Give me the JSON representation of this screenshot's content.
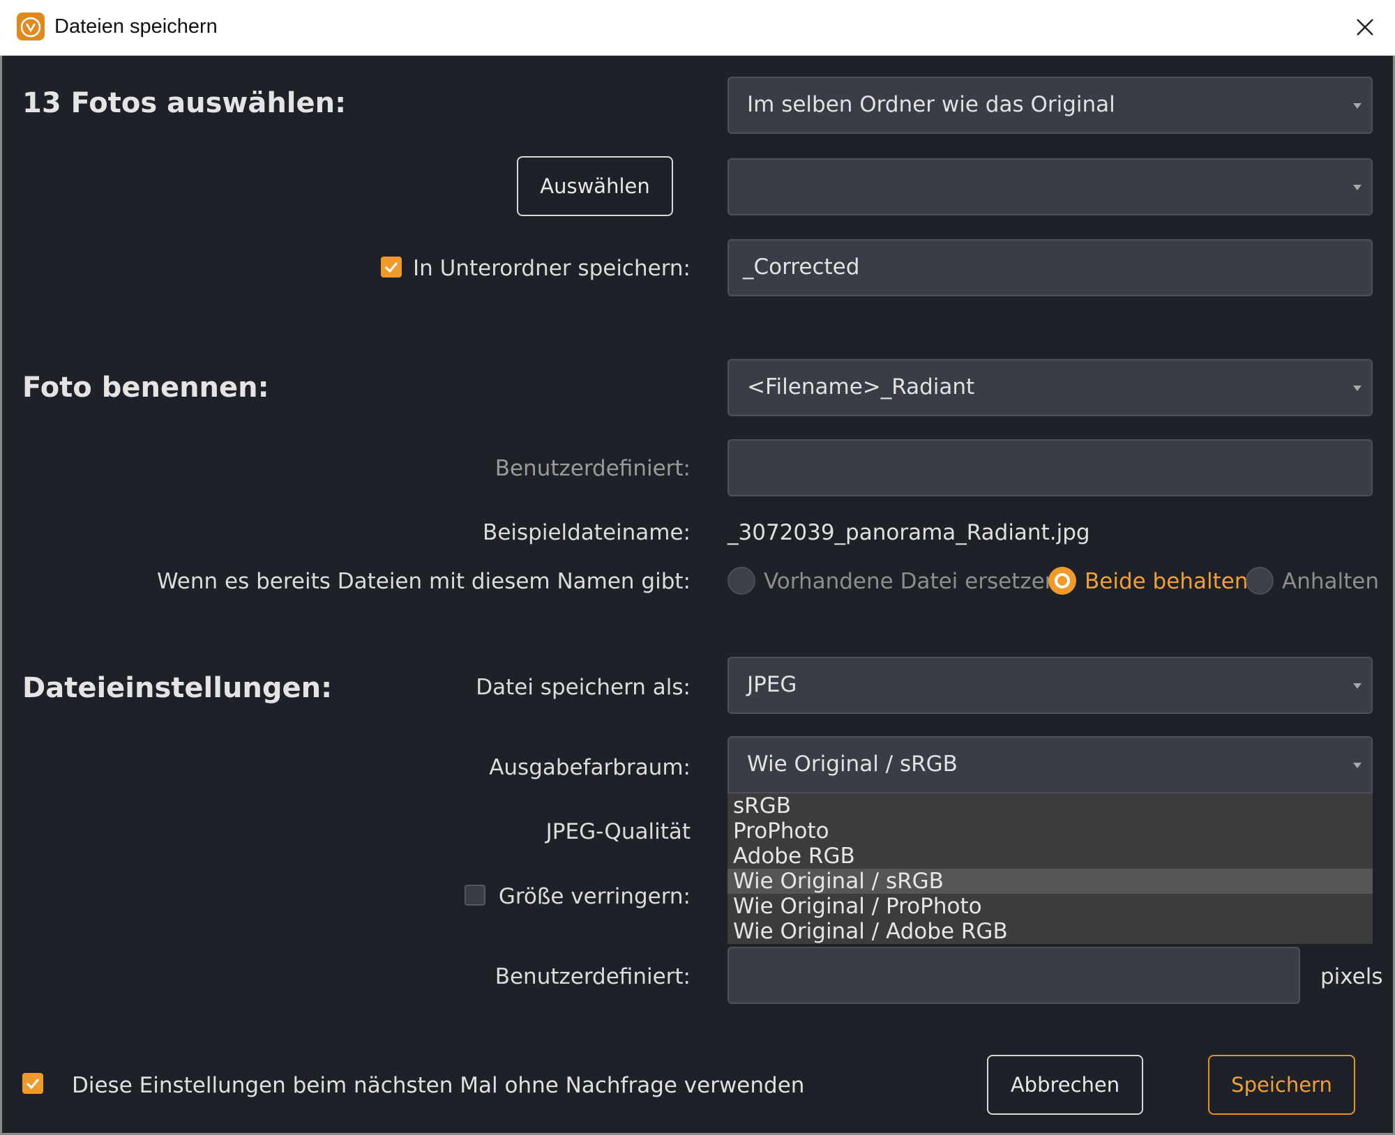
{
  "window": {
    "title": "Dateien speichern",
    "icon": "radiant-lion-icon",
    "close_icon": "close-icon"
  },
  "section_select": {
    "title": "13 Fotos auswählen:",
    "location_dropdown": "Im selben Ordner wie das Original",
    "select_button": "Auswählen",
    "folder_dropdown": "",
    "subfolder_checked": true,
    "subfolder_label": "In Unterordner speichern:",
    "subfolder_value": "_Corrected"
  },
  "section_name": {
    "title": "Foto benennen:",
    "name_pattern_dropdown": "<Filename>_Radiant",
    "custom_label": "Benutzerdefiniert:",
    "custom_value": "",
    "example_label": "Beispieldateiname:",
    "example_value": "_3072039_panorama_Radiant.jpg",
    "conflict_label": "Wenn es bereits Dateien mit diesem Namen gibt:",
    "conflict_options": [
      "Vorhandene Datei ersetzen",
      "Beide behalten",
      "Anhalten"
    ],
    "conflict_selected": "Beide behalten"
  },
  "section_file": {
    "title": "Dateieinstellungen:",
    "format_label": "Datei speichern als:",
    "format_value": "JPEG",
    "colorspace_label": "Ausgabefarbraum:",
    "colorspace_value": "Wie Original / sRGB",
    "colorspace_options": [
      "sRGB",
      "ProPhoto",
      "Adobe RGB",
      "Wie Original / sRGB",
      "Wie Original / ProPhoto",
      "Wie Original / Adobe RGB"
    ],
    "colorspace_highlighted": "Wie Original / sRGB",
    "quality_label": "JPEG-Qualität",
    "resize_checked": false,
    "resize_label": "Größe verringern:",
    "custom_size_label": "Benutzerdefiniert:",
    "custom_size_value": "",
    "pixels_unit": "pixels"
  },
  "footer": {
    "remember_checked": true,
    "remember_label": "Diese Einstellungen beim nächsten Mal ohne Nachfrage verwenden",
    "cancel_label": "Abbrechen",
    "save_label": "Speichern"
  },
  "colors": {
    "accent": "#f19a2c",
    "background": "#1e2128",
    "field": "#3a3d46"
  }
}
